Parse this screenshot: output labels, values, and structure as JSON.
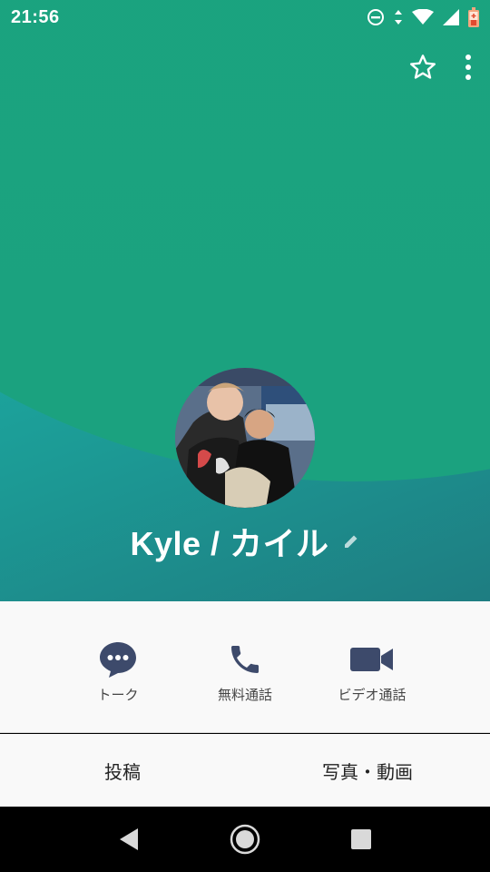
{
  "status_bar": {
    "time": "21:56"
  },
  "profile": {
    "name": "Kyle / カイル"
  },
  "actions": [
    {
      "label": "トーク",
      "icon": "chat-icon"
    },
    {
      "label": "無料通話",
      "icon": "phone-icon"
    },
    {
      "label": "ビデオ通話",
      "icon": "video-icon"
    }
  ],
  "tabs": [
    {
      "label": "投稿"
    },
    {
      "label": "写真・動画"
    }
  ],
  "colors": {
    "header_green": "#1aa57f",
    "header_teal": "#1ab2a8",
    "icon_navy": "#3d4a6b"
  }
}
